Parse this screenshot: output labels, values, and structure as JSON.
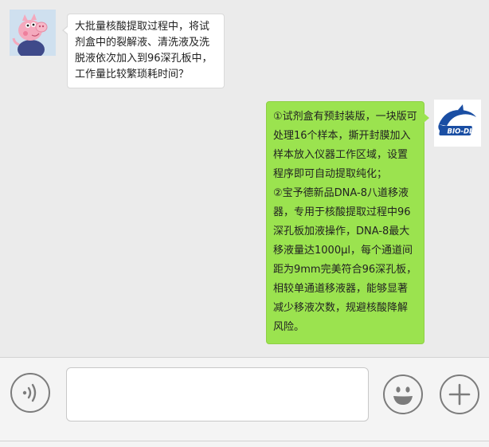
{
  "messages": {
    "incoming": {
      "text": "大批量核酸提取过程中，将试剂盒中的裂解液、清洗液及洗脱液依次加入到96深孔板中，工作量比较繁琐耗时间？"
    },
    "outgoing": {
      "paragraph1": "①试剂盒有预封装版，一块版可处理16个样本，撕开封膜加入样本放入仪器工作区域，设置程序即可自动提取纯化；",
      "paragraph2": "②宝予德新品DNA-8八道移液器，专用于核酸提取过程中96深孔板加液操作，DNA-8最大移液量达1000μl，每个通道间距为9mm完美符合96深孔板，相较单通道移液器，能够显著减少移液次数，规避核酸降解风险。",
      "avatar_logo_text": "BIO-DL"
    }
  },
  "input_bar": {
    "voice_icon": "voice-icon",
    "emoji_icon": "emoji-icon",
    "plus_icon": "plus-icon",
    "text_value": ""
  },
  "colors": {
    "chat_background": "#ebebeb",
    "outgoing_bubble": "#9be34f",
    "incoming_bubble": "#ffffff",
    "logo_blue": "#1a4ea3"
  }
}
